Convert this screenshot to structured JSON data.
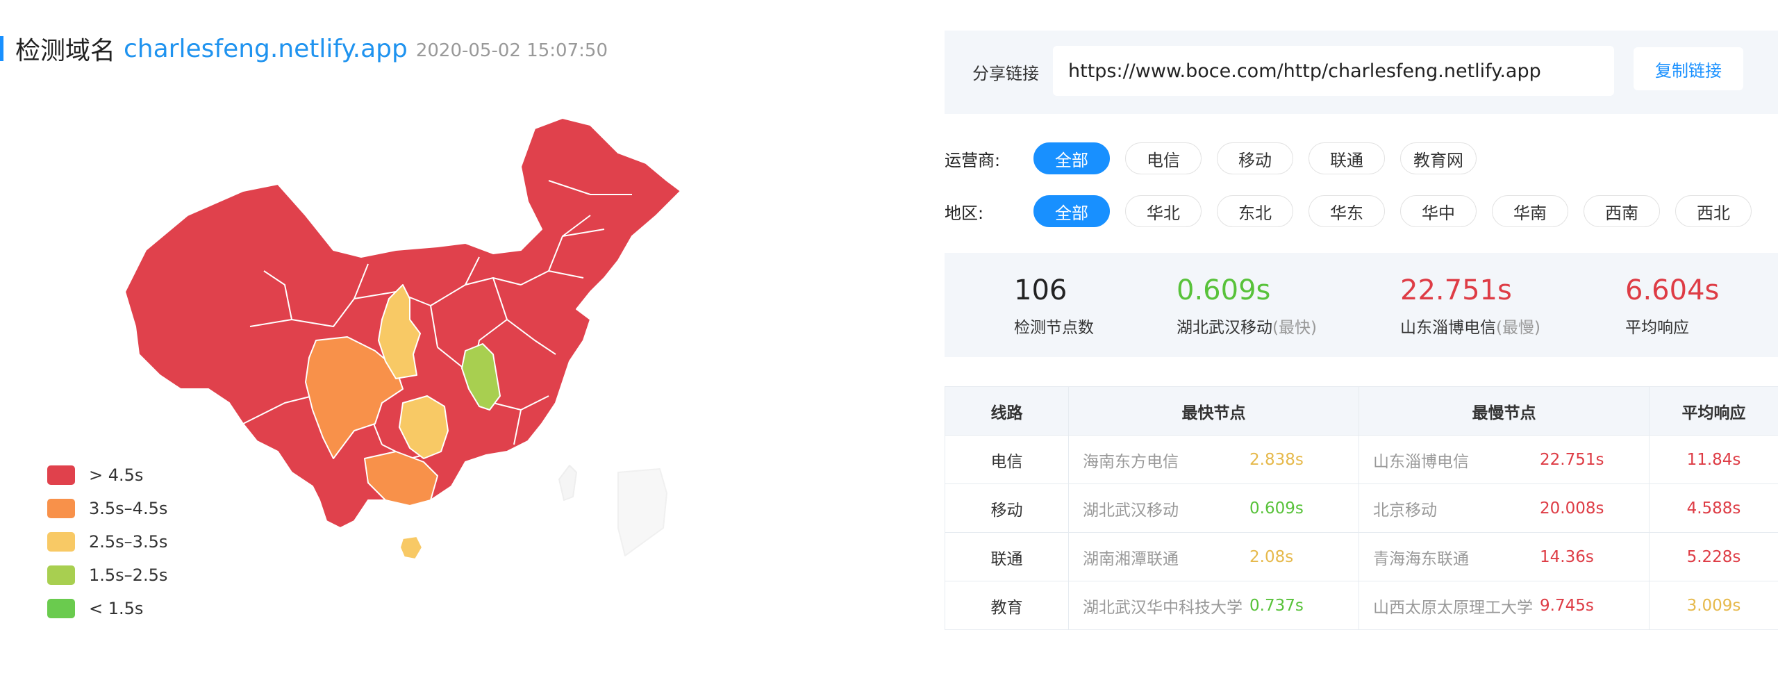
{
  "header": {
    "title_label": "检测域名",
    "domain": "charlesfeng.netlify.app",
    "timestamp": "2020-05-02 15:07:50"
  },
  "legend": [
    {
      "label": "> 4.5s",
      "color": "#e0414c"
    },
    {
      "label": "3.5s–4.5s",
      "color": "#f8914a"
    },
    {
      "label": "2.5s–3.5s",
      "color": "#f8c965"
    },
    {
      "label": "1.5s–2.5s",
      "color": "#a8cf50"
    },
    {
      "label": "< 1.5s",
      "color": "#6acb4e"
    }
  ],
  "share": {
    "label": "分享链接",
    "url": "https://www.boce.com/http/charlesfeng.netlify.app",
    "copy_label": "复制链接"
  },
  "filters": {
    "carrier": {
      "label": "运营商:",
      "options": [
        "全部",
        "电信",
        "移动",
        "联通",
        "教育网"
      ],
      "selected": "全部"
    },
    "region": {
      "label": "地区:",
      "options": [
        "全部",
        "华北",
        "东北",
        "华东",
        "华中",
        "华南",
        "西南",
        "西北"
      ],
      "selected": "全部"
    }
  },
  "stats": [
    {
      "value": "106",
      "label": "检测节点数",
      "suffix": "",
      "color": "#222222"
    },
    {
      "value": "0.609s",
      "label": "湖北武汉移动",
      "suffix": "(最快)",
      "color": "#58c23a"
    },
    {
      "value": "22.751s",
      "label": "山东淄博电信",
      "suffix": "(最慢)",
      "color": "#de3c45"
    },
    {
      "value": "6.604s",
      "label": "平均响应",
      "suffix": "",
      "color": "#de3c45"
    }
  ],
  "table": {
    "headers": [
      "线路",
      "最快节点",
      "最慢节点",
      "平均响应"
    ],
    "rows": [
      {
        "line": "电信",
        "fast_node": "海南东方电信",
        "fast_time": "2.838s",
        "slow_node": "山东淄博电信",
        "slow_time": "22.751s",
        "avg": "11.84s"
      },
      {
        "line": "移动",
        "fast_node": "湖北武汉移动",
        "fast_time": "0.609s",
        "slow_node": "北京移动",
        "slow_time": "20.008s",
        "avg": "4.588s"
      },
      {
        "line": "联通",
        "fast_node": "湖南湘潭联通",
        "fast_time": "2.08s",
        "slow_node": "青海海东联通",
        "slow_time": "14.36s",
        "avg": "5.228s"
      },
      {
        "line": "教育",
        "fast_node": "湖北武汉华中科技大学",
        "fast_time": "0.737s",
        "slow_node": "山西太原太原理工大学",
        "slow_time": "9.745s",
        "avg": "3.009s"
      }
    ]
  }
}
